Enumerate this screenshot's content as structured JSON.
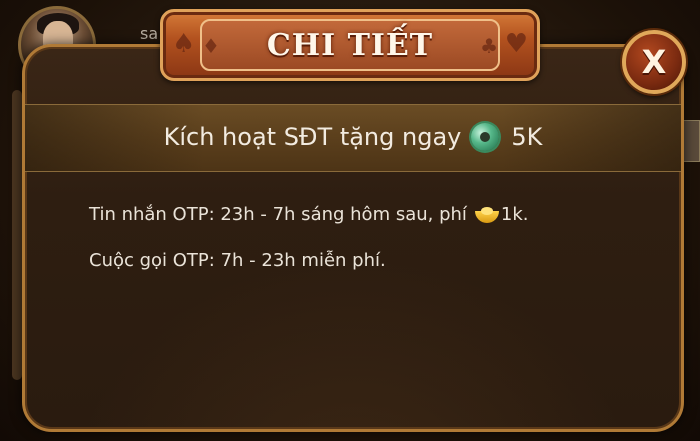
{
  "background": {
    "player_name": "sa"
  },
  "dialog": {
    "title": "CHI TIẾT",
    "close_label": "X",
    "highlight": {
      "text": "Kích hoạt SĐT tặng ngay",
      "reward_icon": "jade-coin-icon",
      "reward_value": "5K"
    },
    "lines": {
      "sms_before_icon": "Tin nhắn OTP: 23h - 7h sáng hôm sau, phí",
      "sms_icon": "gold-ingot-icon",
      "sms_after_icon": "1k.",
      "call": "Cuộc gọi OTP: 7h - 23h miễn phí."
    }
  },
  "colors": {
    "frame_border": "#b07a36",
    "title_plate": "#b3521f",
    "text": "#eae3d8"
  }
}
